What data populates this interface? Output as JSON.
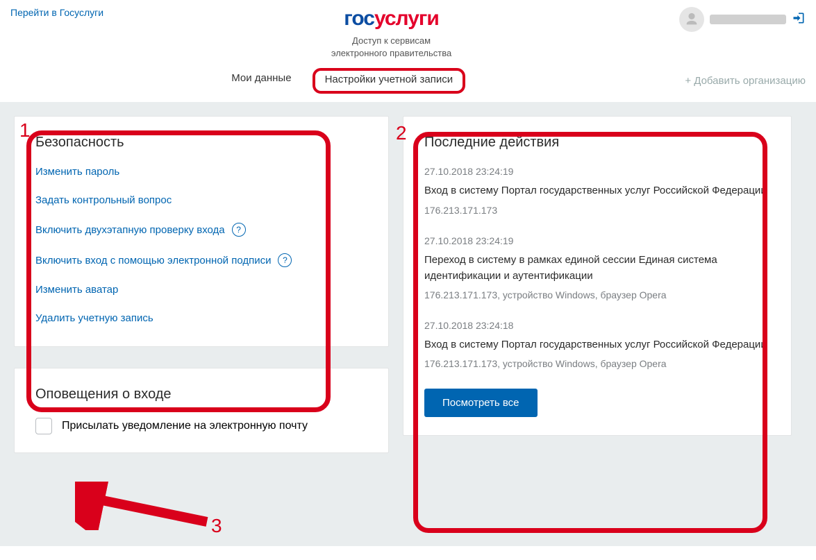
{
  "header": {
    "back_link": "Перейти в Госуслуги",
    "logo_part1": "гос",
    "logo_part2": "услуги",
    "subtitle_l1": "Доступ к сервисам",
    "subtitle_l2": "электронного правительства"
  },
  "tabs": {
    "my_data": "Мои данные",
    "settings": "Настройки учетной записи",
    "add_org": "+ Добавить организацию"
  },
  "security": {
    "title": "Безопасность",
    "change_pwd": "Изменить пароль",
    "set_question": "Задать контрольный вопрос",
    "two_factor": "Включить двухэтапную проверку входа",
    "esig": "Включить вход с помощью электронной подписи",
    "avatar": "Изменить аватар",
    "delete": "Удалить учетную запись"
  },
  "notify": {
    "title": "Оповещения о входе",
    "label": "Присылать уведомление на электронную почту"
  },
  "activity": {
    "title": "Последние действия",
    "items": [
      {
        "time": "27.10.2018 23:24:19",
        "desc": "Вход в систему Портал государственных услуг Российской Федерации",
        "meta": "176.213.171.173"
      },
      {
        "time": "27.10.2018 23:24:19",
        "desc": "Переход в систему в рамках единой сессии Единая система идентификации и аутентификации",
        "meta": "176.213.171.173, устройство Windows, браузер Opera"
      },
      {
        "time": "27.10.2018 23:24:18",
        "desc": "Вход в систему Портал государственных услуг Российской Федерации",
        "meta": "176.213.171.173, устройство Windows, браузер Opera"
      }
    ],
    "view_all": "Посмотреть все"
  },
  "annotations": {
    "n1": "1",
    "n2": "2",
    "n3": "3"
  }
}
